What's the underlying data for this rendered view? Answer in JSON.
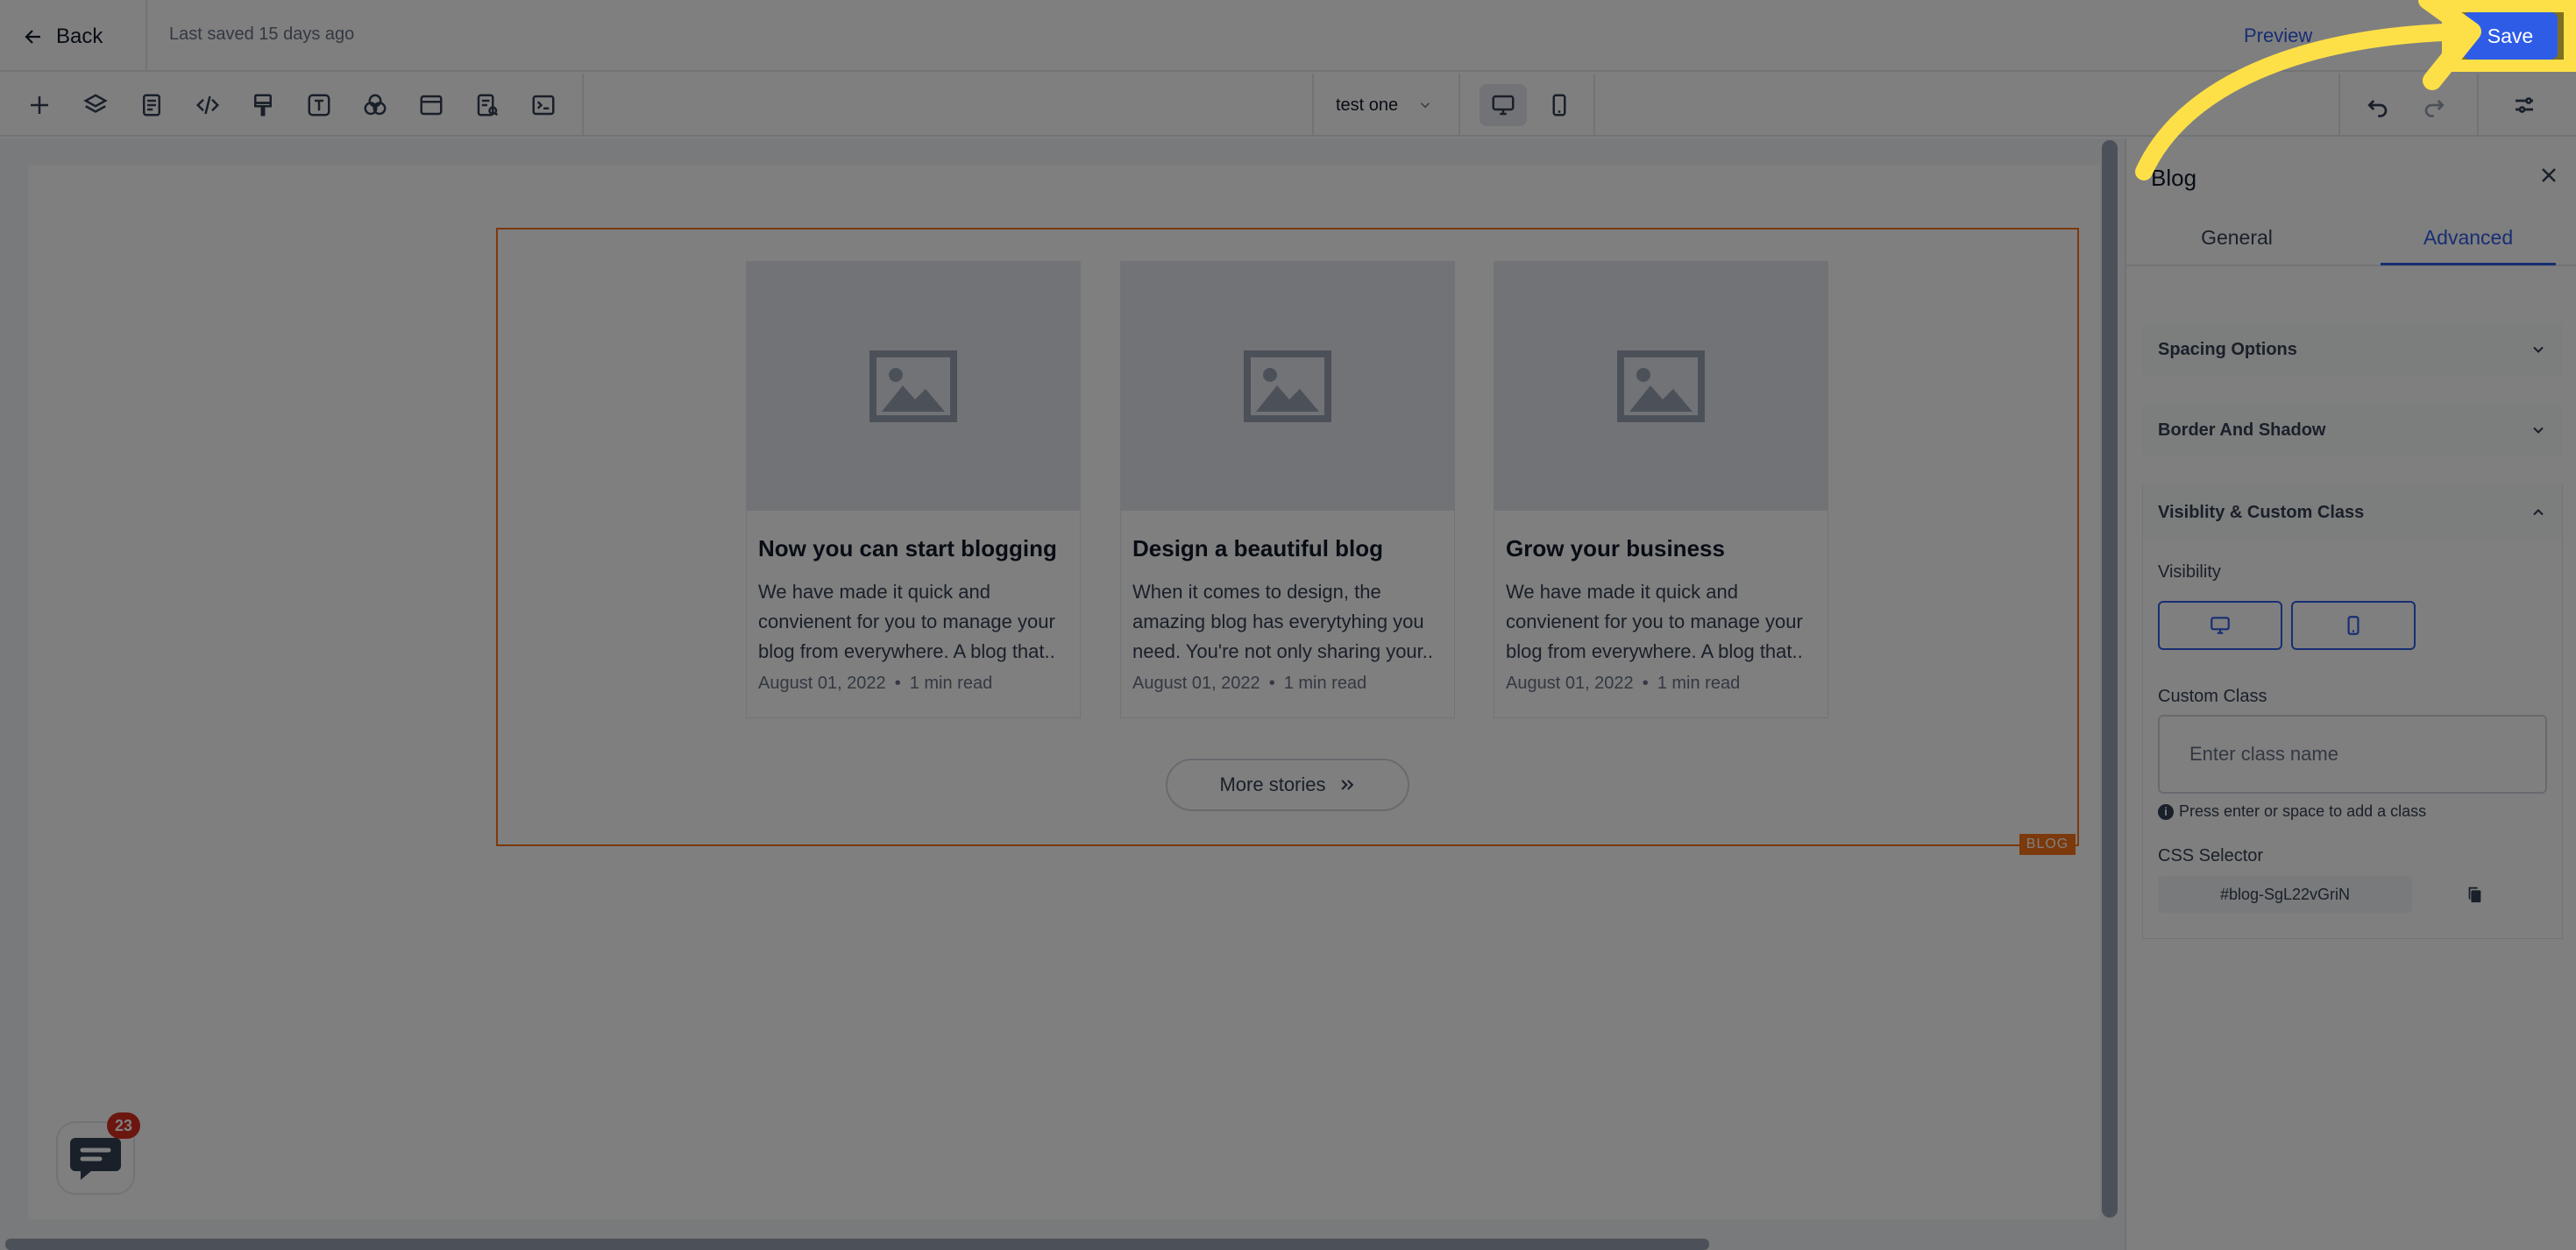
{
  "topbar": {
    "back_label": "Back",
    "saved_text": "Last saved 15 days ago",
    "preview_label": "Preview",
    "save_label": "Save"
  },
  "toolbar": {
    "tools": [
      "add-icon",
      "layers-icon",
      "page-icon",
      "code-icon",
      "paint-brush-icon",
      "text-icon",
      "shapes-icon",
      "browser-icon",
      "search-document-icon",
      "terminal-icon"
    ],
    "page_name": "test one"
  },
  "blog": {
    "posts": [
      {
        "title": "Now you can start blogging",
        "description": "We have made it quick and convienent for you to manage your blog from everywhere. A blog that..",
        "date": "August 01, 2022",
        "read_time": "1 min read"
      },
      {
        "title": "Design a beautiful blog",
        "description": "When it comes to design, the amazing blog has everytyhing you need. You're not only sharing your..",
        "date": "August 01, 2022",
        "read_time": "1 min read"
      },
      {
        "title": "Grow your business",
        "description": "We have made it quick and convienent for you to manage your blog from everywhere. A blog that..",
        "date": "August 01, 2022",
        "read_time": "1 min read"
      }
    ],
    "more_label": "More stories",
    "tag_label": "BLOG"
  },
  "chat": {
    "badge_count": "23"
  },
  "panel": {
    "title": "Blog",
    "tabs": [
      "General",
      "Advanced"
    ],
    "active_tab": "Advanced",
    "sections": {
      "spacing": "Spacing Options",
      "border": "Border And Shadow",
      "visibility": "Visiblity & Custom Class"
    },
    "visibility_label": "Visibility",
    "custom_class_label": "Custom Class",
    "custom_class_placeholder": "Enter class name",
    "hint": "Press enter or space to add a class",
    "css_selector_label": "CSS Selector",
    "css_selector_value": "#blog-SgL22vGriN"
  },
  "colors": {
    "accent": "#2f5ce6",
    "highlight": "#fde047",
    "selection": "#f97316",
    "badge": "#d92d20"
  }
}
